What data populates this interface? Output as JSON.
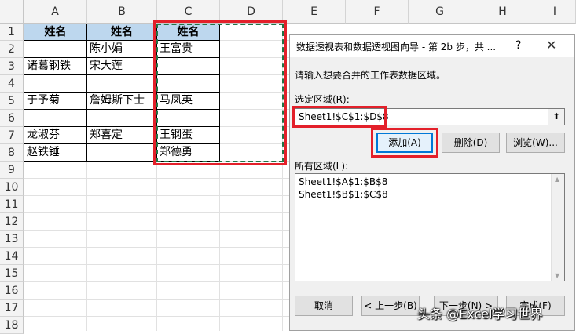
{
  "spreadsheet": {
    "columns": [
      "A",
      "B",
      "C",
      "D",
      "E",
      "F",
      "G",
      "H",
      "I"
    ],
    "rows": [
      "1",
      "2",
      "3",
      "4",
      "5",
      "6",
      "7",
      "8",
      "9",
      "10",
      "11",
      "12",
      "13",
      "14",
      "15",
      "16",
      "17",
      "18"
    ],
    "cells": {
      "A1": "姓名",
      "B1": "姓名",
      "C1": "姓名",
      "B2": "陈小娟",
      "C2": "王富贵",
      "A3": "诸葛钢铁",
      "B3": "宋大莲",
      "A5": "于予菊",
      "B5": "詹姆斯下士",
      "C5": "马凤英",
      "A7": "龙淑芬",
      "B7": "郑喜定",
      "C7": "王钢蛋",
      "A8": "赵铁锤",
      "C8": "郑德勇"
    },
    "header_fill_color": "#bdd7ee",
    "highlight_color": "#e3202a"
  },
  "dialog": {
    "title": "数据透视表和数据透视图向导 - 第 2b 步，共 ...",
    "help_glyph": "?",
    "close_glyph": "✕",
    "instruction": "请输入想要合并的工作表数据区域。",
    "range_label": "选定区域(R):",
    "range_value": "Sheet1!$C$1:$D$8",
    "collapse_glyph": "⬆",
    "add_label": "添加(A)",
    "delete_label": "删除(D)",
    "browse_label": "浏览(W)...",
    "all_ranges_label": "所有区域(L):",
    "all_ranges": [
      "Sheet1!$A$1:$B$8",
      "Sheet1!$B$1:$C$8"
    ],
    "cancel_label": "取消",
    "back_label": "< 上一步(B)",
    "next_label": "下一步(N) >",
    "finish_label": "完成(F)"
  },
  "watermark": "头条 @Excel学习世界"
}
